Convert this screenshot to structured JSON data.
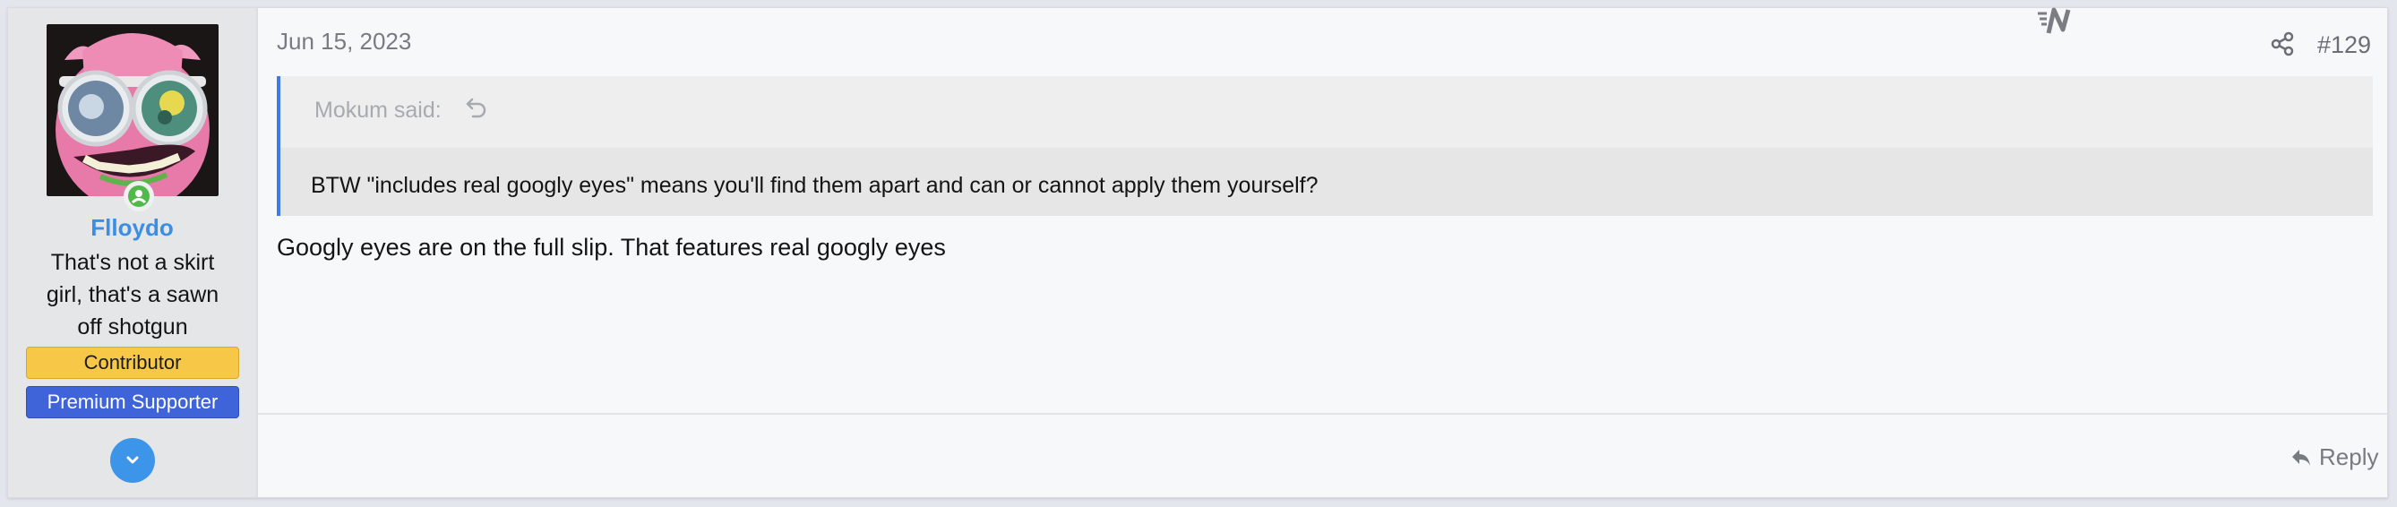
{
  "user": {
    "username": "Flloydo",
    "title": "That's not a skirt girl, that's a sawn off shotgun",
    "banners": [
      "Contributor",
      "Premium Supporter"
    ],
    "avatar_icon": "avatar-image",
    "online_icon": "online-indicator-icon",
    "expand_icon": "chevron-down-icon"
  },
  "post": {
    "date": "Jun 15, 2023",
    "number": "#129",
    "share_icon": "share-icon",
    "logo_icon": "n-logo-icon"
  },
  "quote": {
    "author": "Mokum said:",
    "jump_icon": "arrow-jump-icon",
    "text": "BTW \"includes real googly eyes\" means you'll find them apart and can or cannot apply them yourself?"
  },
  "message": {
    "text": "Googly eyes are on the full slip. That features real googly eyes"
  },
  "actions": {
    "reply_label": "Reply",
    "reply_icon": "reply-icon"
  },
  "colors": {
    "accent": "#3f7be6",
    "username": "#3a8ee6",
    "contributor_banner": "#f7c847",
    "premium_banner": "#3f63d9"
  }
}
